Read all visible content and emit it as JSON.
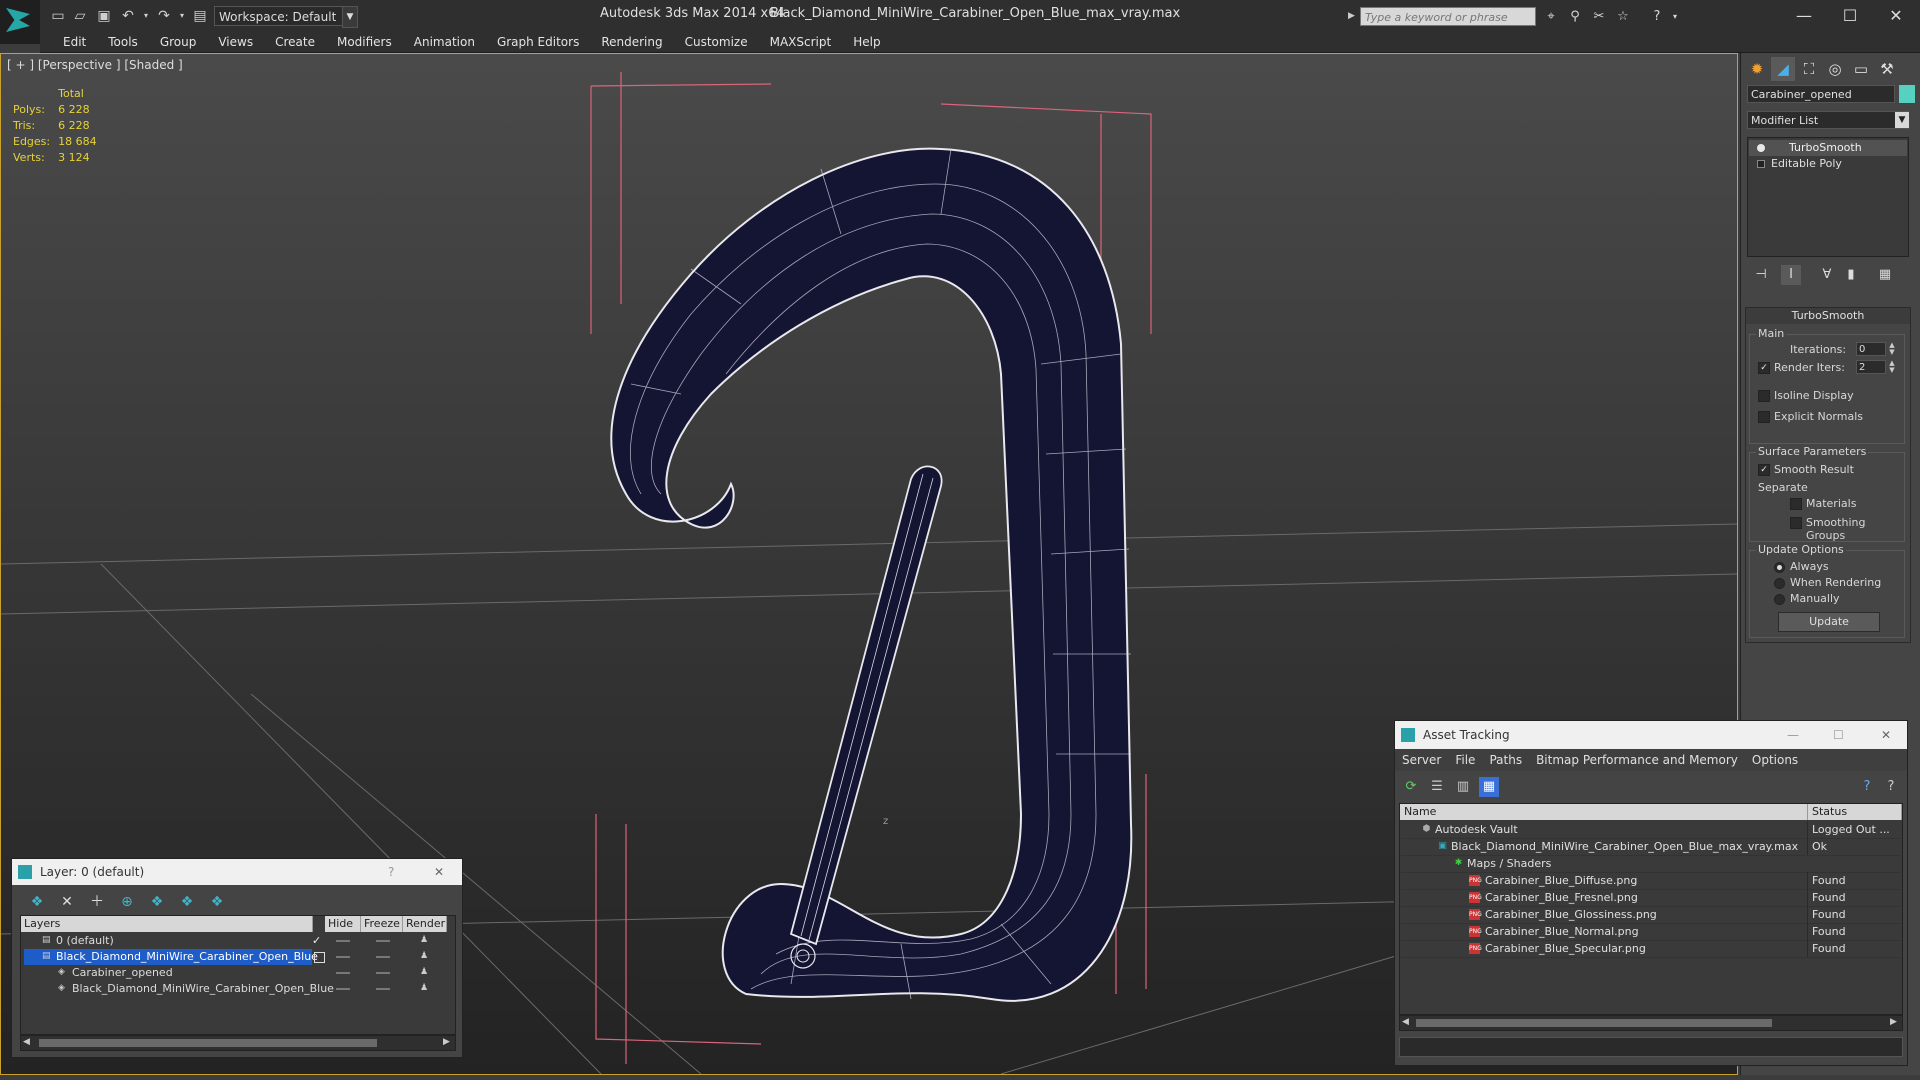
{
  "titlebar": {
    "workspace": "Workspace: Default",
    "app_title": "Autodesk 3ds Max 2014 x64",
    "file_title": "Black_Diamond_MiniWire_Carabiner_Open_Blue_max_vray.max",
    "search_placeholder": "Type a keyword or phrase",
    "minimize": "—",
    "maximize": "☐",
    "close": "✕"
  },
  "menu": [
    "Edit",
    "Tools",
    "Group",
    "Views",
    "Create",
    "Modifiers",
    "Animation",
    "Graph Editors",
    "Rendering",
    "Customize",
    "MAXScript",
    "Help"
  ],
  "viewport": {
    "label": "[ + ] [Perspective ] [Shaded ]",
    "stats_header": "Total",
    "stats": [
      {
        "label": "Polys:",
        "value": "6 228"
      },
      {
        "label": "Tris:",
        "value": "6 228"
      },
      {
        "label": "Edges:",
        "value": "18 684"
      },
      {
        "label": "Verts:",
        "value": "3 124"
      }
    ],
    "axis_label": "z"
  },
  "command_panel": {
    "object_name": "Carabiner_opened",
    "object_color": "#57d0c0",
    "modifier_list": "Modifier List",
    "stack": [
      "TurboSmooth",
      "Editable Poly"
    ],
    "rollout_title": "TurboSmooth",
    "main_group": "Main",
    "iterations_label": "Iterations:",
    "iterations_value": "0",
    "render_iters_label": "Render Iters:",
    "render_iters_value": "2",
    "isoline_label": "Isoline Display",
    "explicit_normals_label": "Explicit Normals",
    "surface_group": "Surface Parameters",
    "smooth_result_label": "Smooth Result",
    "separate_label": "Separate",
    "materials_label": "Materials",
    "smoothing_groups_label": "Smoothing Groups",
    "update_group": "Update Options",
    "always_label": "Always",
    "when_rendering_label": "When Rendering",
    "manually_label": "Manually",
    "update_button": "Update"
  },
  "layer_dialog": {
    "title": "Layer: 0 (default)",
    "help": "?",
    "close": "✕",
    "columns": [
      "Layers",
      "Hide",
      "Freeze",
      "Render"
    ],
    "rows": [
      {
        "name": "0 (default)"
      },
      {
        "name": "Black_Diamond_MiniWire_Carabiner_Open_Blue"
      },
      {
        "name": "Carabiner_opened"
      },
      {
        "name": "Black_Diamond_MiniWire_Carabiner_Open_Blue"
      }
    ]
  },
  "asset_dialog": {
    "title": "Asset Tracking",
    "minimize": "—",
    "maximize": "☐",
    "close": "✕",
    "menu": [
      "Server",
      "File",
      "Paths",
      "Bitmap Performance and Memory",
      "Options"
    ],
    "columns": [
      "Name",
      "Status"
    ],
    "rows": [
      {
        "name": "Autodesk Vault",
        "status": "Logged Out ..."
      },
      {
        "name": "Black_Diamond_MiniWire_Carabiner_Open_Blue_max_vray.max",
        "status": "Ok"
      },
      {
        "name": "Maps / Shaders",
        "status": ""
      },
      {
        "name": "Carabiner_Blue_Diffuse.png",
        "status": "Found"
      },
      {
        "name": "Carabiner_Blue_Fresnel.png",
        "status": "Found"
      },
      {
        "name": "Carabiner_Blue_Glossiness.png",
        "status": "Found"
      },
      {
        "name": "Carabiner_Blue_Normal.png",
        "status": "Found"
      },
      {
        "name": "Carabiner_Blue_Specular.png",
        "status": "Found"
      }
    ]
  }
}
